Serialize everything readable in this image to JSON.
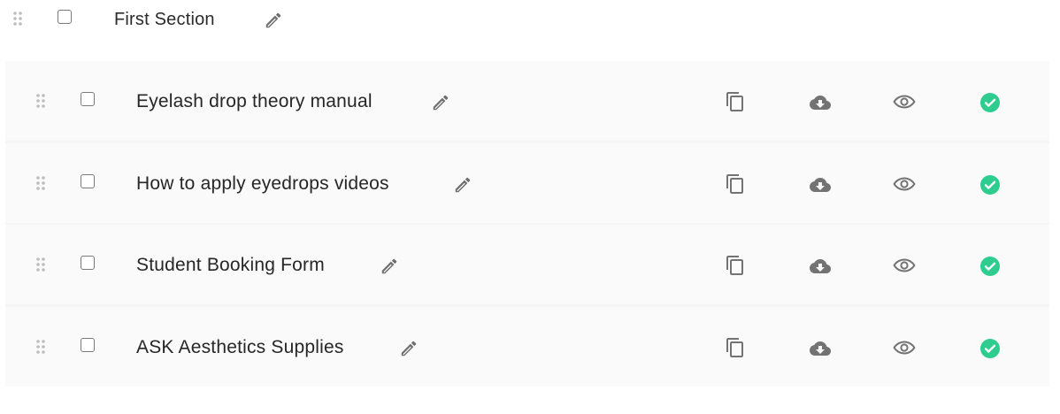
{
  "section": {
    "title": "First Section"
  },
  "items": [
    {
      "label": "Eyelash drop theory manual",
      "published": true
    },
    {
      "label": "How to apply eyedrops videos",
      "published": true
    },
    {
      "label": "Student Booking Form",
      "published": true
    },
    {
      "label": "ASK Aesthetics Supplies",
      "published": true
    }
  ],
  "icons": {
    "drag": "drag-handle-icon",
    "checkbox": "checkbox",
    "edit": "pencil-icon",
    "copy": "copy-icon",
    "download": "cloud-download-icon",
    "preview": "eye-icon",
    "status": "check-circle-icon"
  },
  "colors": {
    "icon_gray": "#767676",
    "drag_gray": "#b8b8b8",
    "status_green": "#2ecc8f",
    "row_bg": "#fafafa",
    "text": "#262626"
  }
}
